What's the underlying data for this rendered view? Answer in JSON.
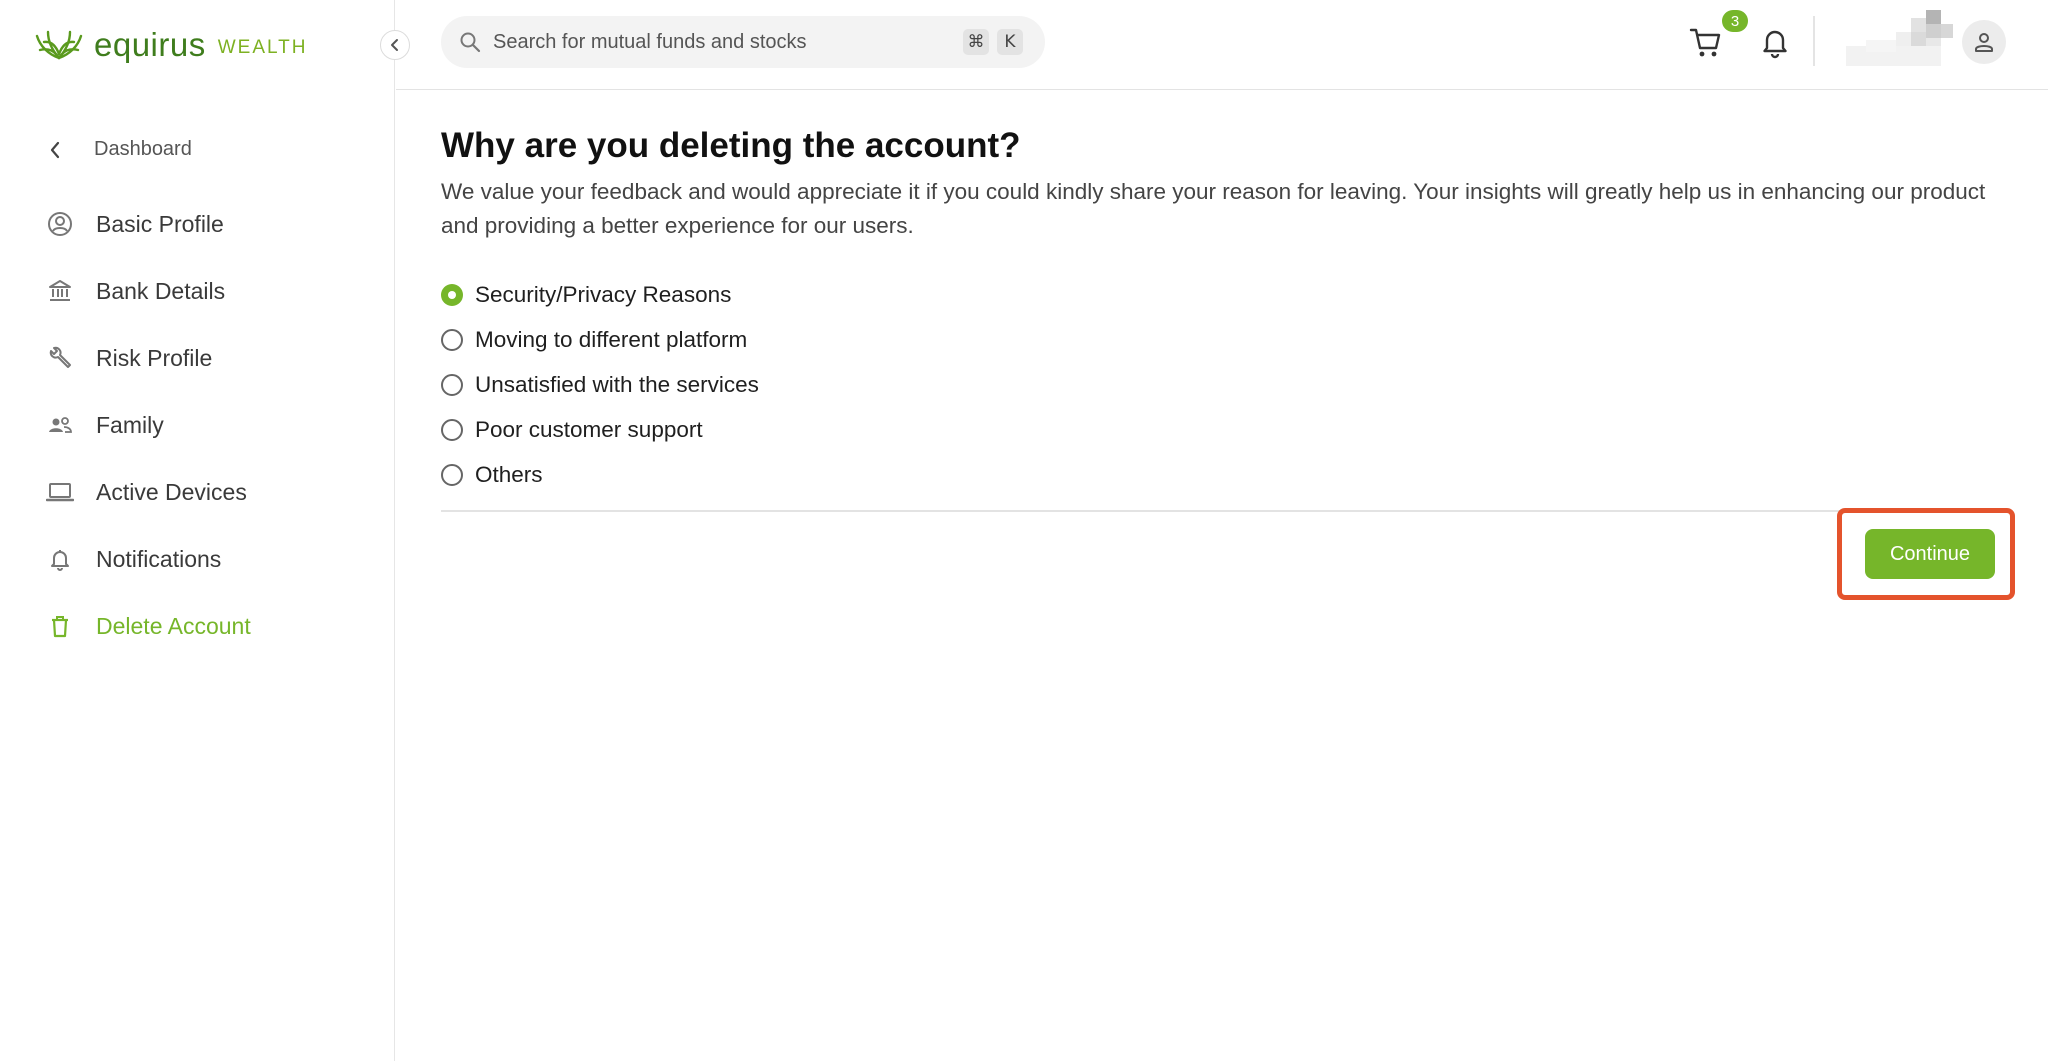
{
  "brand": {
    "name": "equirus",
    "subtitle": "WEALTH",
    "accent_color": "#76b62a",
    "logo_color": "#3f7d1d"
  },
  "sidebar": {
    "back_label": "Dashboard",
    "items": [
      {
        "label": "Basic Profile",
        "icon": "user-circle-icon"
      },
      {
        "label": "Bank Details",
        "icon": "bank-icon"
      },
      {
        "label": "Risk Profile",
        "icon": "wrench-icon"
      },
      {
        "label": "Family",
        "icon": "people-icon"
      },
      {
        "label": "Active Devices",
        "icon": "laptop-icon"
      },
      {
        "label": "Notifications",
        "icon": "bell-icon"
      },
      {
        "label": "Delete Account",
        "icon": "trash-icon",
        "active": true
      }
    ]
  },
  "header": {
    "search_placeholder": "Search for mutual funds and stocks",
    "shortcut_keys": [
      "⌘",
      "K"
    ],
    "cart_count": "3"
  },
  "main": {
    "title": "Why are you deleting the account?",
    "description": "We value your feedback and would appreciate it if you could kindly share your reason for leaving. Your insights will greatly help us in enhancing our product and providing a better experience for our users.",
    "options": [
      {
        "label": "Security/Privacy Reasons",
        "selected": true
      },
      {
        "label": "Moving to different platform",
        "selected": false
      },
      {
        "label": "Unsatisfied with the services",
        "selected": false
      },
      {
        "label": "Poor customer support",
        "selected": false
      },
      {
        "label": "Others",
        "selected": false
      }
    ],
    "continue_label": "Continue",
    "highlight_color": "#e4532c"
  }
}
